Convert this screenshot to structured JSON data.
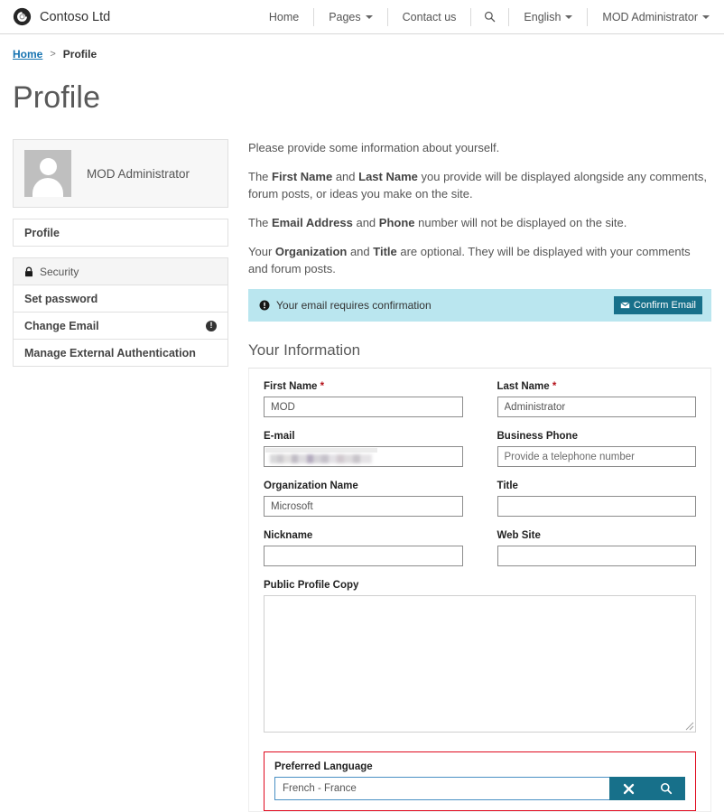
{
  "navbar": {
    "brand": "Contoso Ltd",
    "logo_icon": "contoso-ring-logo",
    "items": [
      {
        "label": "Home",
        "icon": null,
        "caret": false
      },
      {
        "label": "Pages",
        "icon": null,
        "caret": true
      },
      {
        "label": "Contact us",
        "icon": null,
        "caret": false
      },
      {
        "label": "",
        "icon": "search-icon",
        "caret": false
      },
      {
        "label": "English",
        "icon": null,
        "caret": true
      },
      {
        "label": "MOD Administrator",
        "icon": null,
        "caret": true
      }
    ]
  },
  "breadcrumb": {
    "home": "Home",
    "separator": ">",
    "current": "Profile"
  },
  "page": {
    "title": "Profile"
  },
  "sidebar": {
    "profile_card": {
      "name": "MOD Administrator",
      "avatar_icon": "user-avatar-placeholder-icon"
    },
    "primary": [
      {
        "label": "Profile"
      }
    ],
    "security_header": {
      "label": "Security",
      "icon": "lock-icon"
    },
    "security_items": [
      {
        "label": "Set password",
        "badge": null
      },
      {
        "label": "Change Email",
        "badge": "!"
      },
      {
        "label": "Manage External Authentication",
        "badge": null
      }
    ]
  },
  "intro": {
    "p1": "Please provide some information about yourself.",
    "p2_a": "The ",
    "p2_b1": "First Name",
    "p2_c": " and ",
    "p2_b2": "Last Name",
    "p2_d": " you provide will be displayed alongside any comments, forum posts, or ideas you make on the site.",
    "p3_a": "The ",
    "p3_b1": "Email Address",
    "p3_c": " and ",
    "p3_b2": "Phone",
    "p3_d": " number will not be displayed on the site.",
    "p4_a": "Your ",
    "p4_b1": "Organization",
    "p4_c": " and ",
    "p4_b2": "Title",
    "p4_d": " are optional. They will be displayed with your comments and forum posts."
  },
  "alert": {
    "icon": "info-circle-icon",
    "message": "Your email requires confirmation",
    "button_label": "Confirm Email",
    "button_icon": "envelope-icon",
    "background_color": "#bae6ef",
    "button_color": "#17708a"
  },
  "form": {
    "section_title": "Your Information",
    "first_name": {
      "label": "First Name",
      "required": "*",
      "value": "MOD",
      "placeholder": ""
    },
    "last_name": {
      "label": "Last Name",
      "required": "*",
      "value": "Administrator",
      "placeholder": ""
    },
    "email": {
      "label": "E-mail",
      "value": "",
      "placeholder": "",
      "redacted": true
    },
    "business_phone": {
      "label": "Business Phone",
      "value": "",
      "placeholder": "Provide a telephone number"
    },
    "organization_name": {
      "label": "Organization Name",
      "value": "Microsoft",
      "placeholder": ""
    },
    "title": {
      "label": "Title",
      "value": "",
      "placeholder": ""
    },
    "nickname": {
      "label": "Nickname",
      "value": "",
      "placeholder": ""
    },
    "web_site": {
      "label": "Web Site",
      "value": "",
      "placeholder": ""
    },
    "public_profile_copy": {
      "label": "Public Profile Copy",
      "value": "",
      "placeholder": ""
    },
    "preferred_language": {
      "label": "Preferred Language",
      "value": "French - France",
      "placeholder": "",
      "clear_icon": "clear-x-icon",
      "search_icon": "search-icon",
      "highlight_color": "#e00a1e",
      "button_color": "#17708a"
    }
  }
}
